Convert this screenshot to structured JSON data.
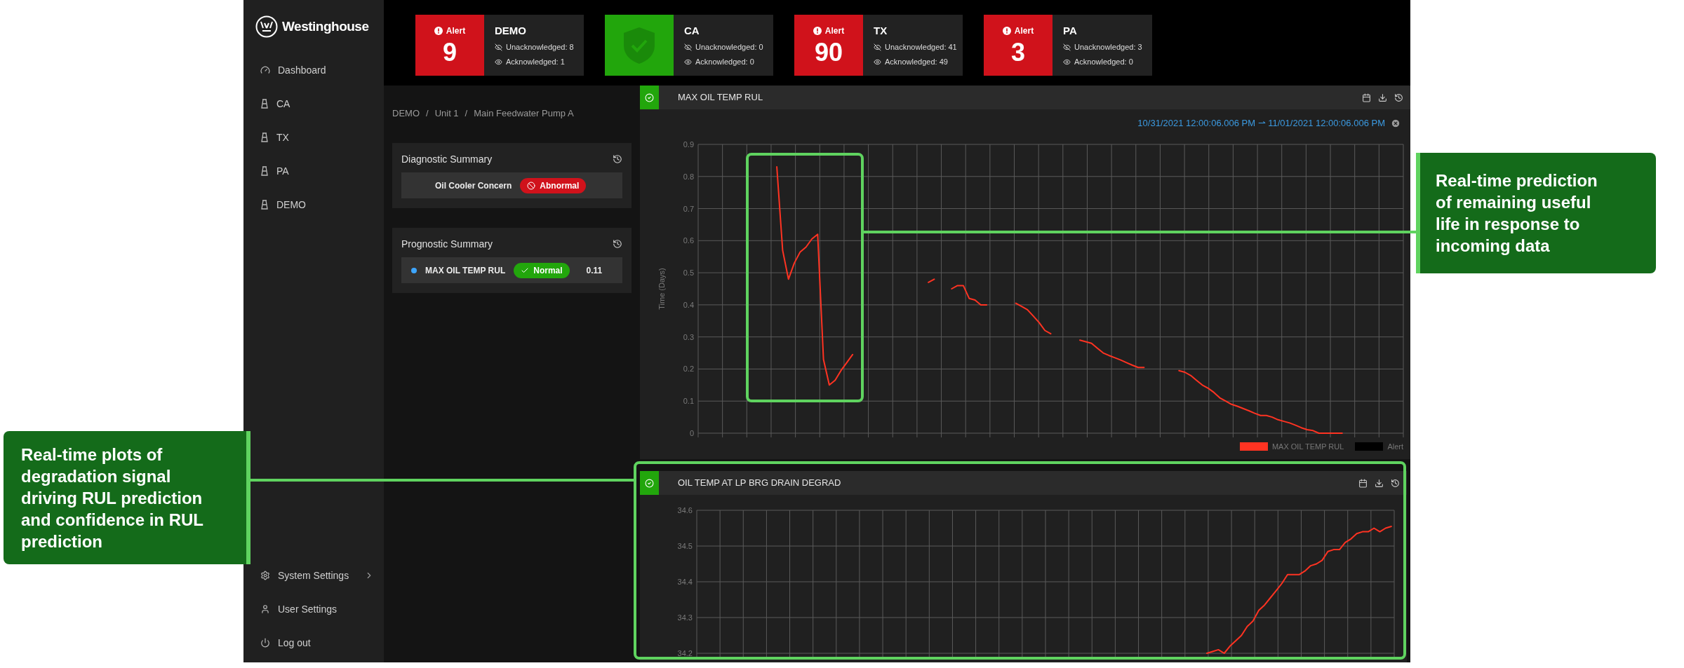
{
  "sidebar": {
    "logo_text": "Westinghouse",
    "items": [
      {
        "label": "Dashboard",
        "kind": "dashboard"
      },
      {
        "label": "CA",
        "kind": "site"
      },
      {
        "label": "TX",
        "kind": "site"
      },
      {
        "label": "PA",
        "kind": "site"
      },
      {
        "label": "DEMO",
        "kind": "site"
      }
    ],
    "bottom_items": [
      {
        "label": "System Settings",
        "kind": "settings",
        "expandable": true
      },
      {
        "label": "User Settings",
        "kind": "user",
        "expandable": false
      },
      {
        "label": "Log out",
        "kind": "logout",
        "expandable": false
      }
    ]
  },
  "alerts": [
    {
      "site": "DEMO",
      "kind": "alert",
      "badge": "Alert",
      "count": "9",
      "unacknowledged": "Unacknowledged: 8",
      "acknowledged": "Acknowledged: 1"
    },
    {
      "site": "CA",
      "kind": "ok",
      "unacknowledged": "Unacknowledged: 0",
      "acknowledged": "Acknowledged: 0"
    },
    {
      "site": "TX",
      "kind": "alert",
      "badge": "Alert",
      "count": "90",
      "unacknowledged": "Unacknowledged: 41",
      "acknowledged": "Acknowledged: 49"
    },
    {
      "site": "PA",
      "kind": "alert",
      "badge": "Alert",
      "count": "3",
      "unacknowledged": "Unacknowledged: 3",
      "acknowledged": "Acknowledged: 0"
    }
  ],
  "breadcrumb": {
    "separator": "/",
    "items": [
      "DEMO",
      "Unit 1",
      "Main Feedwater Pump A"
    ]
  },
  "diagnostic_summary": {
    "title": "Diagnostic Summary",
    "rows": [
      {
        "label": "Oil Cooler Concern",
        "status": "Abnormal",
        "kind": "abnormal"
      }
    ]
  },
  "prognostic_summary": {
    "title": "Prognostic Summary",
    "rows": [
      {
        "label": "MAX OIL TEMP RUL",
        "status": "Normal",
        "kind": "normal",
        "value": "0.11",
        "color": "#3ea6ff"
      }
    ]
  },
  "panels": [
    {
      "title": "MAX OIL TEMP RUL",
      "healthy": true,
      "date_range": "10/31/2021 12:00:06.006 PM ⇀ 11/01/2021 12:00:06.006 PM",
      "chart_data": {
        "type": "line",
        "grid": true,
        "ylabel": "Time (Days)",
        "ylim": [
          0,
          0.9
        ],
        "yticks": [
          0,
          0.1,
          0.2,
          0.3,
          0.4,
          0.5,
          0.6,
          0.7,
          0.8,
          0.9
        ],
        "categories": [
          null,
          null,
          null,
          null,
          null,
          null,
          null,
          null,
          null,
          null,
          null,
          null,
          null,
          null,
          null,
          null,
          null,
          null,
          null,
          null,
          null,
          null,
          null,
          null,
          null,
          null,
          null,
          null,
          null,
          null,
          null,
          null,
          null,
          null,
          null,
          null,
          null,
          null,
          null,
          null,
          null,
          null,
          null,
          null,
          null,
          null,
          null,
          null,
          null,
          null,
          null,
          null,
          null,
          null,
          null,
          null,
          null,
          null,
          null,
          null,
          null,
          null,
          null,
          null,
          null,
          null,
          null,
          null,
          null,
          null,
          null,
          null,
          null,
          null,
          null,
          null,
          null,
          null,
          null,
          null,
          null,
          null,
          null,
          null,
          null,
          null,
          null,
          null,
          null,
          null,
          null,
          null,
          null,
          null,
          null,
          null,
          null,
          null,
          null,
          null,
          null,
          null,
          null,
          null,
          null,
          null,
          null,
          null,
          null,
          null,
          null,
          null,
          null,
          null,
          null,
          null,
          null,
          null,
          null,
          null,
          null
        ],
        "series": [
          {
            "name": "MAX OIL TEMP RUL",
            "color": "#ff3322",
            "values": [
              null,
              null,
              null,
              null,
              null,
              null,
              null,
              null,
              null,
              null,
              null,
              null,
              null,
              0.83,
              0.57,
              0.48,
              0.53,
              0.565,
              0.58,
              0.605,
              0.62,
              0.23,
              0.15,
              0.165,
              0.195,
              0.22,
              0.245,
              null,
              null,
              null,
              null,
              null,
              null,
              null,
              null,
              null,
              null,
              null,
              null,
              0.47,
              0.48,
              null,
              null,
              0.45,
              0.46,
              0.46,
              0.42,
              0.415,
              0.4,
              0.4,
              null,
              null,
              null,
              null,
              0.405,
              0.395,
              0.385,
              0.365,
              0.345,
              0.32,
              0.31,
              null,
              null,
              null,
              null,
              0.29,
              0.285,
              0.28,
              0.265,
              0.25,
              0.242,
              0.235,
              0.228,
              0.22,
              0.212,
              0.205,
              0.205,
              null,
              null,
              null,
              null,
              null,
              0.195,
              0.19,
              0.18,
              0.165,
              0.15,
              0.14,
              0.127,
              0.11,
              0.1,
              0.09,
              0.084,
              0.077,
              0.07,
              0.062,
              0.055,
              0.055,
              0.05,
              0.042,
              0.037,
              0.032,
              0.025,
              0.017,
              0.011,
              0.008,
              0,
              0,
              0,
              0,
              0,
              null,
              null,
              null,
              null,
              null,
              null,
              null,
              null,
              null,
              null
            ]
          }
        ]
      },
      "alert_legend": {
        "label": "Alert",
        "color": "#000000"
      }
    },
    {
      "title": "OIL TEMP AT LP BRG DRAIN DEGRAD",
      "healthy": true,
      "chart_data": {
        "type": "line",
        "grid": true,
        "ylim": [
          34.2,
          34.6
        ],
        "yticks": [
          34.2,
          34.3,
          34.4,
          34.5,
          34.6
        ],
        "categories": [
          null,
          null,
          null,
          null,
          null,
          null,
          null,
          null,
          null,
          null,
          null,
          null,
          null,
          null,
          null,
          null,
          null,
          null,
          null,
          null,
          null,
          null,
          null,
          null,
          null,
          null,
          null,
          null,
          null,
          null,
          null,
          null,
          null,
          null,
          null,
          null,
          null,
          null,
          null,
          null,
          null,
          null,
          null,
          null,
          null,
          null,
          null,
          null,
          null,
          null,
          null,
          null,
          null,
          null,
          null,
          null,
          null,
          null,
          null,
          null,
          null,
          null,
          null,
          null,
          null,
          null,
          null,
          null,
          null,
          null,
          null,
          null,
          null,
          null,
          null,
          null,
          null,
          null,
          null,
          null,
          null,
          null,
          null,
          null,
          null,
          null,
          null,
          null,
          null,
          null,
          null,
          null,
          null,
          null,
          null,
          null,
          null,
          null,
          null,
          null,
          null,
          null,
          null,
          null,
          null,
          null,
          null,
          null,
          null,
          null,
          null,
          null,
          null,
          null,
          null,
          null,
          null,
          null,
          null,
          null,
          null
        ],
        "series": [
          {
            "color": "#ff3322",
            "values": [
              null,
              null,
              null,
              null,
              null,
              null,
              null,
              null,
              null,
              null,
              null,
              null,
              null,
              null,
              null,
              null,
              null,
              null,
              null,
              null,
              null,
              null,
              null,
              null,
              null,
              null,
              null,
              null,
              null,
              null,
              null,
              null,
              null,
              null,
              null,
              null,
              null,
              null,
              null,
              null,
              null,
              null,
              null,
              null,
              null,
              null,
              null,
              null,
              null,
              null,
              null,
              null,
              null,
              null,
              null,
              null,
              null,
              null,
              null,
              null,
              null,
              null,
              null,
              null,
              null,
              null,
              null,
              null,
              null,
              null,
              null,
              null,
              null,
              null,
              null,
              null,
              null,
              null,
              null,
              null,
              null,
              null,
              null,
              null,
              null,
              null,
              null,
              null,
              34.2,
              34.205,
              34.21,
              34.2,
              34.22,
              34.235,
              34.25,
              34.275,
              34.29,
              34.32,
              34.335,
              34.355,
              34.375,
              34.395,
              34.42,
              34.42,
              34.42,
              34.43,
              34.445,
              34.45,
              34.46,
              34.485,
              34.49,
              34.49,
              34.51,
              34.52,
              34.535,
              34.54,
              34.54,
              34.55,
              34.54,
              34.55,
              34.555
            ]
          }
        ]
      }
    }
  ],
  "callouts": [
    {
      "text": "Real-time prediction of remaining useful life in response to incoming data"
    },
    {
      "text": "Real-time plots of degradation signal driving RUL prediction and confidence in RUL prediction"
    }
  ]
}
